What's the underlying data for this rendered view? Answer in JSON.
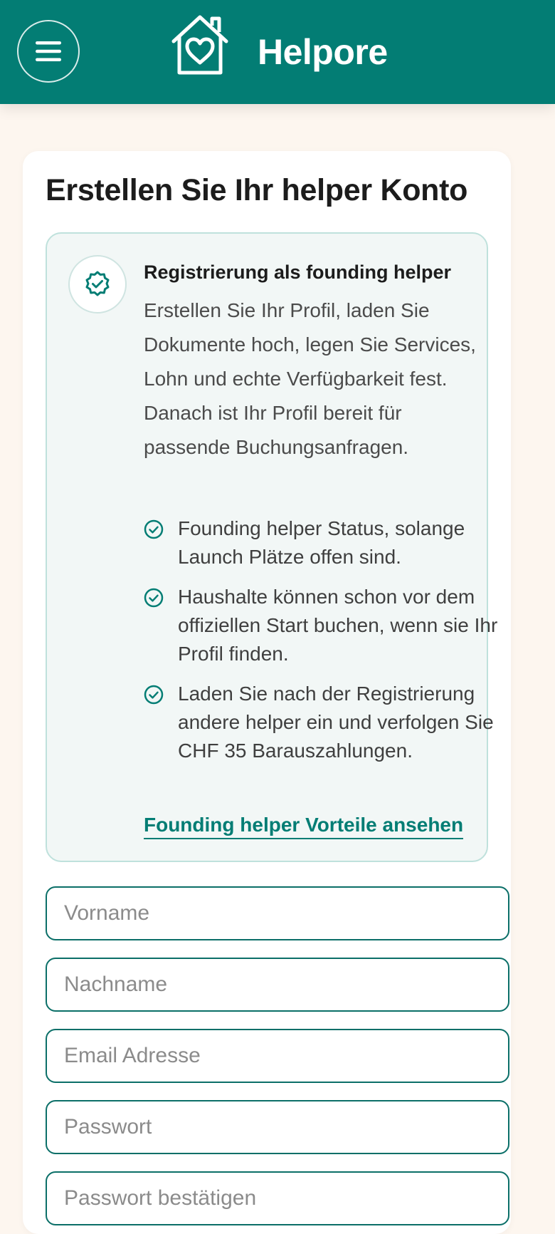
{
  "header": {
    "brand": "Helpore",
    "menu_icon": "menu-icon",
    "logo_icon": "house-heart-icon",
    "color": "#037d74"
  },
  "card": {
    "title": "Erstellen Sie Ihr helper Konto"
  },
  "info": {
    "icon": "badge-check-icon",
    "title": "Registrierung als founding helper",
    "description": "Erstellen Sie Ihr Profil, laden Sie Dokumente hoch, legen Sie Services, Lohn und echte Verfügbarkeit fest. Danach ist Ihr Profil bereit für passende Buchungsanfragen.",
    "benefits": [
      "Founding helper Status, solange Launch Plätze offen sind.",
      "Haushalte können schon vor dem offiziellen Start buchen, wenn sie Ihr Profil finden.",
      "Laden Sie nach der Registrierung andere helper ein und verfolgen Sie CHF 35 Barauszahlungen."
    ],
    "link": "Founding helper Vorteile ansehen"
  },
  "form": {
    "first_name_placeholder": "Vorname",
    "last_name_placeholder": "Nachname",
    "email_placeholder": "Email Adresse",
    "password_placeholder": "Passwort",
    "confirm_password_placeholder": "Passwort bestätigen"
  }
}
